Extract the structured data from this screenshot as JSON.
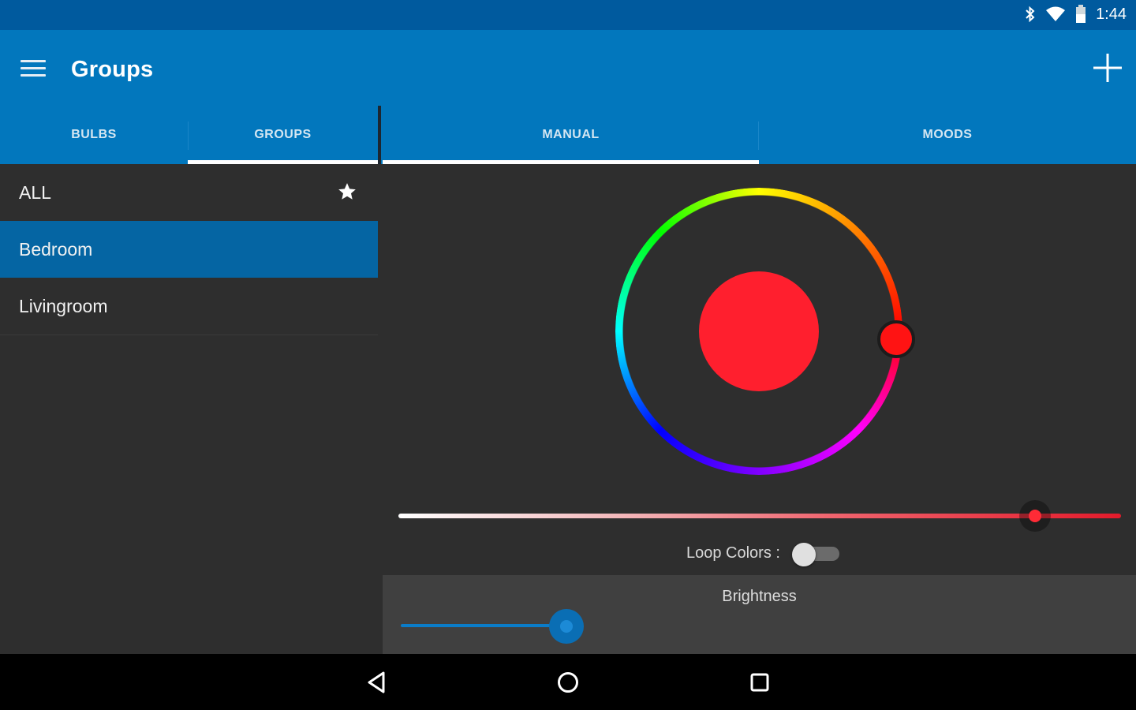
{
  "status_bar": {
    "time": "1:44",
    "icons": [
      "bluetooth-icon",
      "wifi-icon",
      "battery-icon"
    ]
  },
  "app_bar": {
    "title": "Groups",
    "menu_icon": "hamburger-menu-icon",
    "add_icon": "plus-icon"
  },
  "tabs": {
    "left": [
      {
        "label": "BULBS",
        "selected": false
      },
      {
        "label": "GROUPS",
        "selected": true
      }
    ],
    "right": [
      {
        "label": "MANUAL",
        "selected": true
      },
      {
        "label": "MOODS",
        "selected": false
      }
    ]
  },
  "groups": [
    {
      "label": "ALL",
      "favorite": true,
      "selected": false
    },
    {
      "label": "Bedroom",
      "favorite": false,
      "selected": true
    },
    {
      "label": "Livingroom",
      "favorite": false,
      "selected": false
    }
  ],
  "manual": {
    "selected_color": "#ff1f2e",
    "saturation_level": 0.88,
    "loop_colors_label": "Loop Colors :",
    "loop_colors_on": false,
    "brightness_label": "Brightness",
    "brightness_level": 0.24
  },
  "colors": {
    "primary": "#0277bd",
    "primary_dark": "#005a9e",
    "selected_row": "#0565a3",
    "background": "#2e2e2e"
  },
  "nav_bar": {
    "buttons": [
      "back-icon",
      "home-icon",
      "recents-icon"
    ]
  }
}
